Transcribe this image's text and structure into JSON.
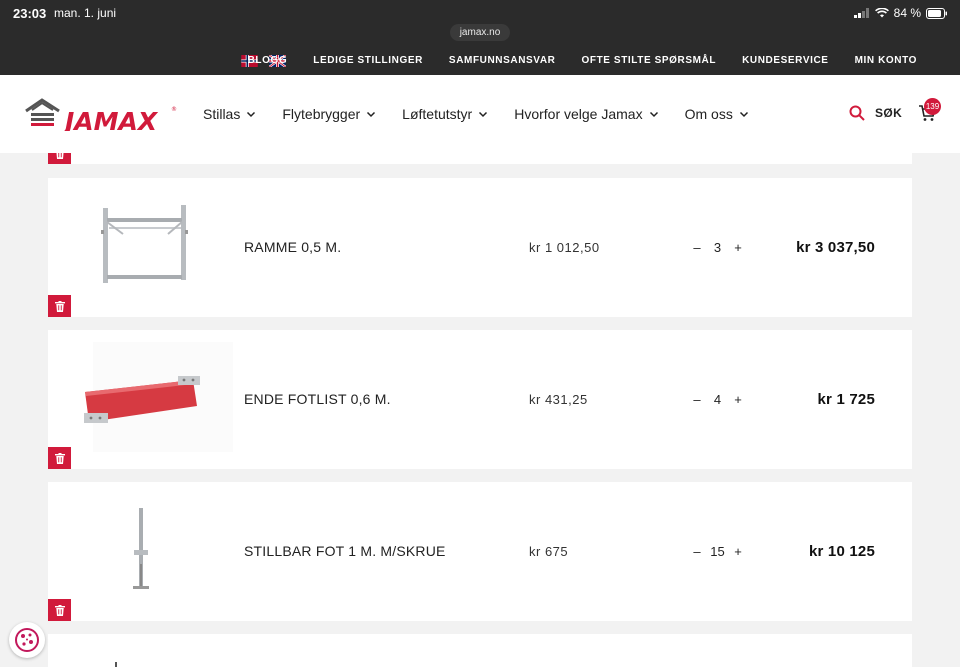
{
  "status": {
    "time": "23:03",
    "date": "man. 1. juni",
    "battery": "84 %",
    "url": "jamax.no"
  },
  "topbar": {
    "links": [
      "BLOGG",
      "LEDIGE STILLINGER",
      "SAMFUNNSANSVAR",
      "OFTE STILTE SPØRSMÅL",
      "KUNDESERVICE",
      "MIN KONTO"
    ]
  },
  "header": {
    "logo": "JAMAX",
    "nav": [
      "Stillas",
      "Flytebrygger",
      "Løftetutstyr",
      "Hvorfor velge Jamax",
      "Om oss"
    ],
    "search_label": "SØK",
    "cart_count": "139"
  },
  "cart": {
    "items": [
      {
        "name": "RAMME 0,5 M.",
        "price": "kr 1 012,50",
        "qty": "3",
        "total": "kr 3 037,50",
        "image": "frame"
      },
      {
        "name": "ENDE FOTLIST 0,6 M.",
        "price": "kr 431,25",
        "qty": "4",
        "total": "kr 1 725",
        "image": "toe-board"
      },
      {
        "name": "STILLBAR FOT 1 M. M/SKRUE",
        "price": "kr 675",
        "qty": "15",
        "total": "kr 10 125",
        "image": "base-jack"
      }
    ],
    "minus_label": "–",
    "plus_label": "+"
  },
  "colors": {
    "brand": "#d11a3b",
    "dark": "#2b2b2b"
  }
}
